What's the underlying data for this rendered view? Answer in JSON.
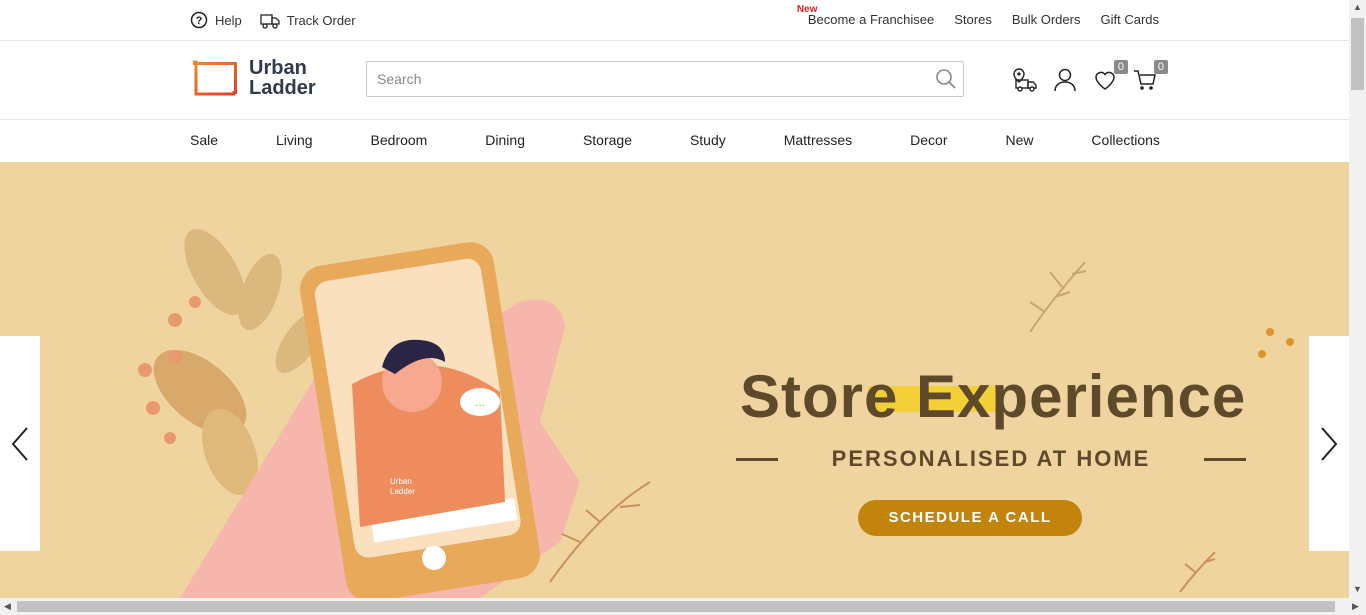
{
  "topbar": {
    "help": "Help",
    "track_order": "Track Order",
    "new_tag": "New",
    "franchise": "Become a Franchisee",
    "stores": "Stores",
    "bulk_orders": "Bulk Orders",
    "gift_cards": "Gift Cards"
  },
  "header": {
    "logo_line1": "Urban",
    "logo_line2": "Ladder",
    "search_placeholder": "Search",
    "wishlist_count": "0",
    "cart_count": "0"
  },
  "nav": [
    "Sale",
    "Living",
    "Bedroom",
    "Dining",
    "Storage",
    "Study",
    "Mattresses",
    "Decor",
    "New",
    "Collections"
  ],
  "hero": {
    "title": "Store Experience",
    "subtitle": "PERSONALISED AT HOME",
    "cta": "SCHEDULE A CALL",
    "phone_brand_line1": "Urban",
    "phone_brand_line2": "Ladder",
    "chat_text": "..."
  },
  "colors": {
    "hero_bg": "#efd4a0",
    "title": "#5e4a2a",
    "highlight": "#f3cf38",
    "cta": "#c2840c",
    "logo_orange": "#e8632b"
  }
}
